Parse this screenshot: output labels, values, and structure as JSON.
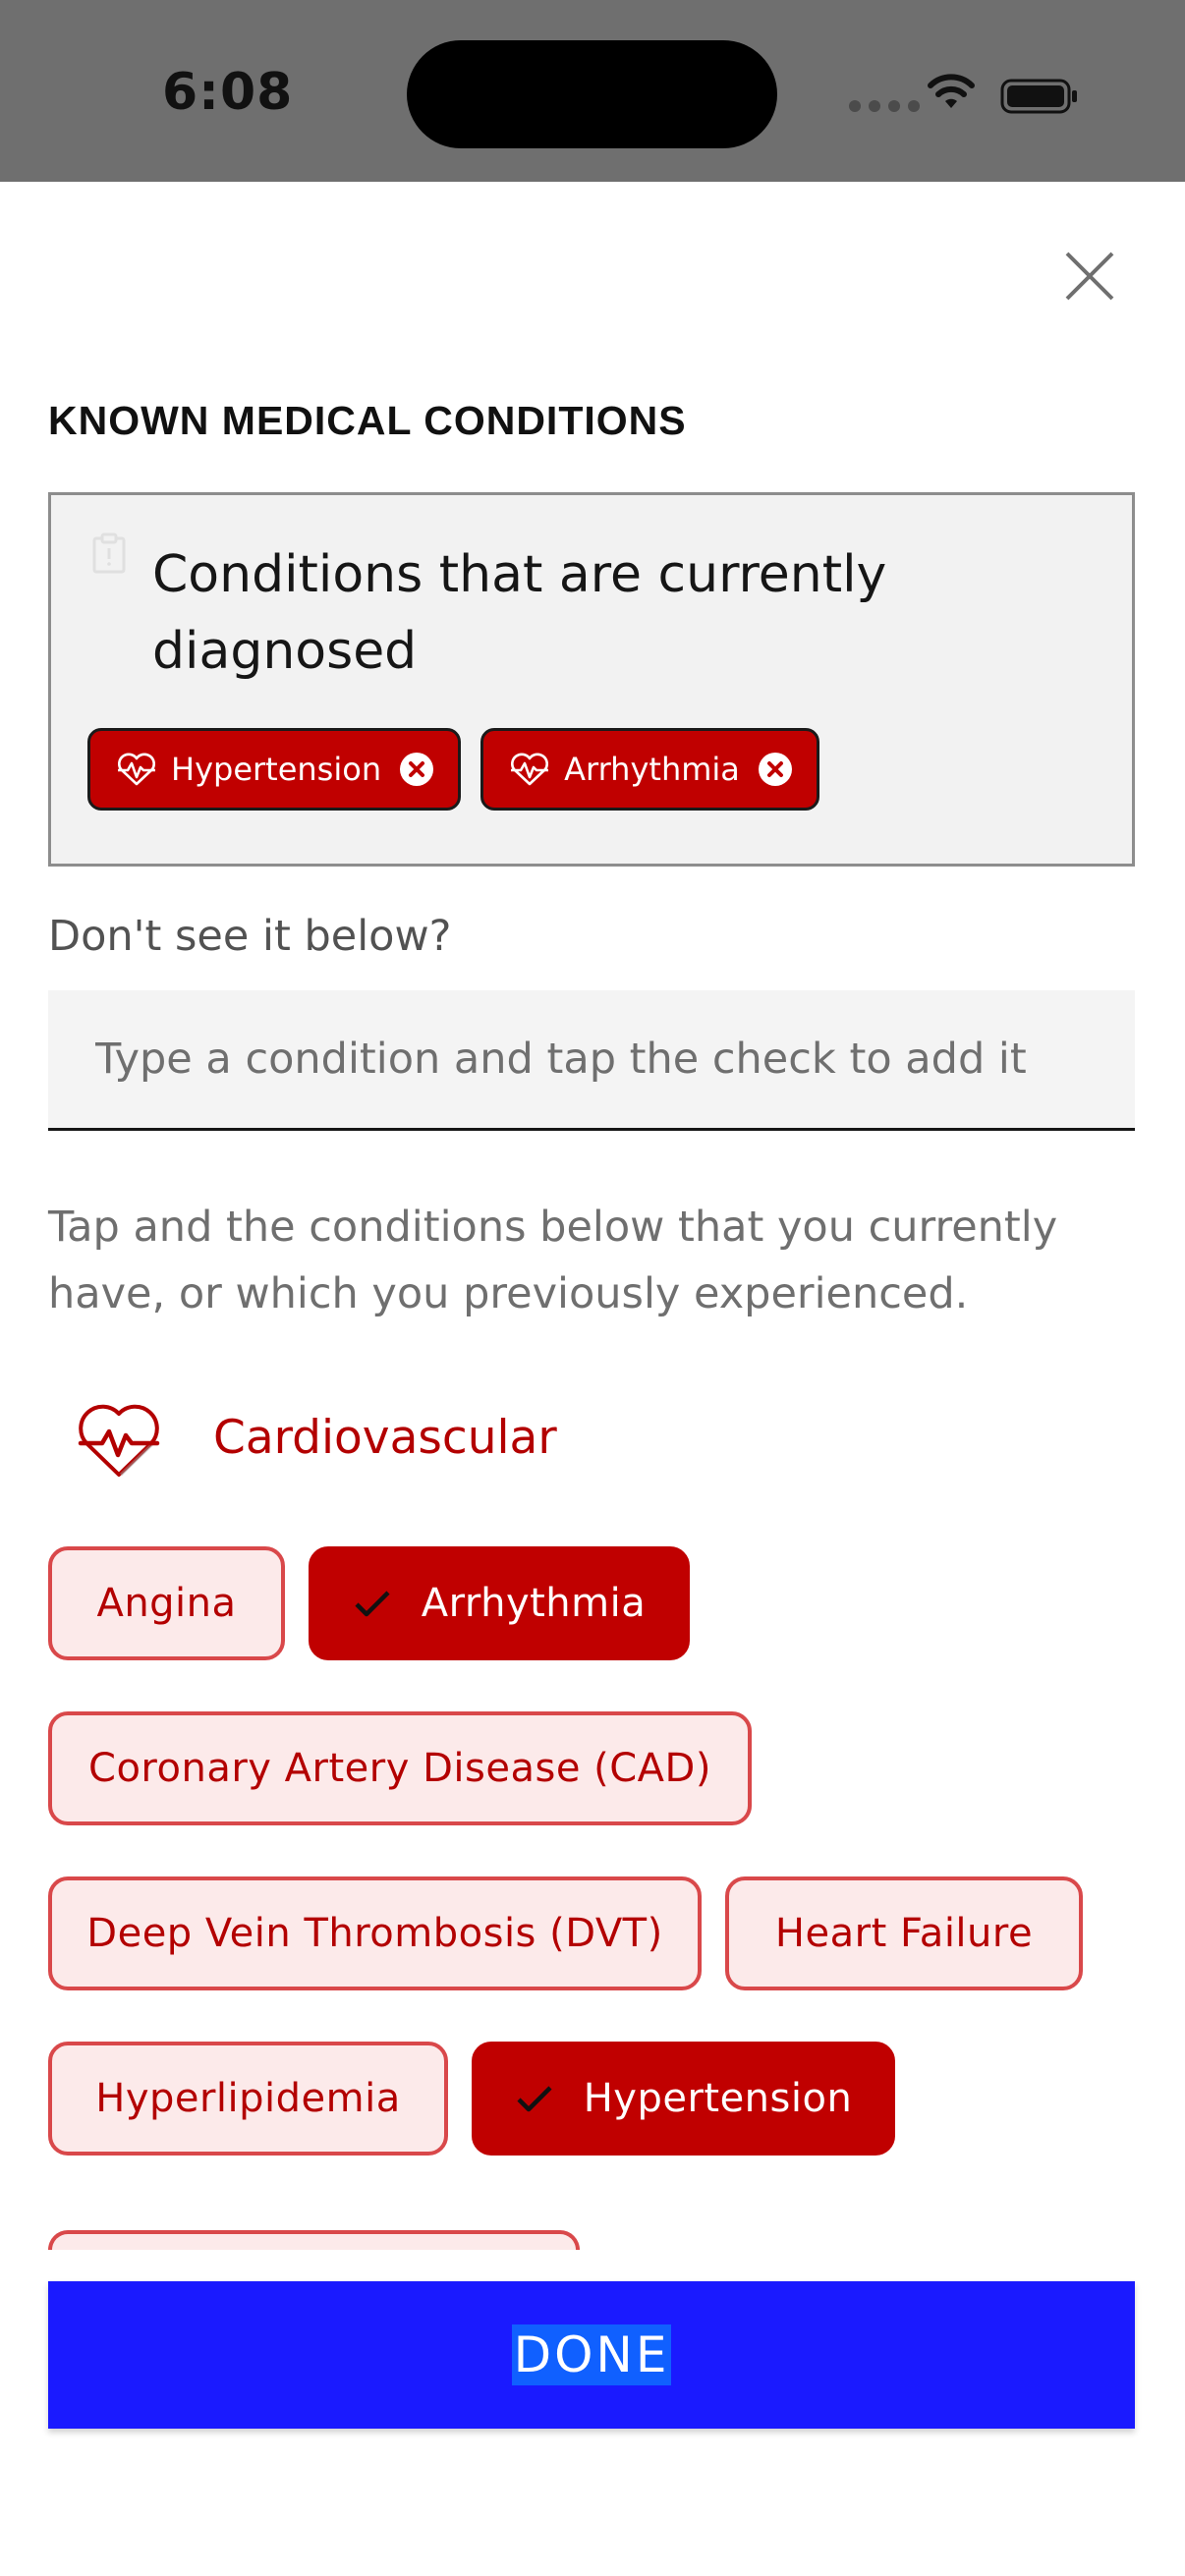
{
  "status_bar": {
    "time": "6:08"
  },
  "modal": {
    "heading": "KNOWN MEDICAL CONDITIONS",
    "diagnosed": {
      "title": "Conditions that are currently diagnosed",
      "chips": [
        {
          "label": "Hypertension",
          "icon": "heartbeat-icon"
        },
        {
          "label": "Arrhythmia",
          "icon": "heartbeat-icon"
        }
      ]
    },
    "custom": {
      "prompt": "Don't see it below?",
      "placeholder": "Type a condition and tap the check to add it",
      "value": ""
    },
    "instructions": "Tap and the conditions below that you currently have, or which you previously experienced.",
    "category": {
      "title": "Cardiovascular",
      "icon": "heartbeat-icon",
      "options": [
        {
          "label": "Angina",
          "selected": false
        },
        {
          "label": "Arrhythmia",
          "selected": true
        },
        {
          "label": "Coronary Artery Disease (CAD)",
          "selected": false
        },
        {
          "label": "Deep Vein Thrombosis (DVT)",
          "selected": false
        },
        {
          "label": "Heart Failure",
          "selected": false
        },
        {
          "label": "Hyperlipidemia",
          "selected": false
        },
        {
          "label": "Hypertension",
          "selected": true
        }
      ]
    },
    "done_label": "DONE"
  },
  "colors": {
    "accent_red": "#c00000",
    "option_bg": "#fceaea",
    "option_border": "#d9484a",
    "done_blue": "#1a1aff"
  }
}
